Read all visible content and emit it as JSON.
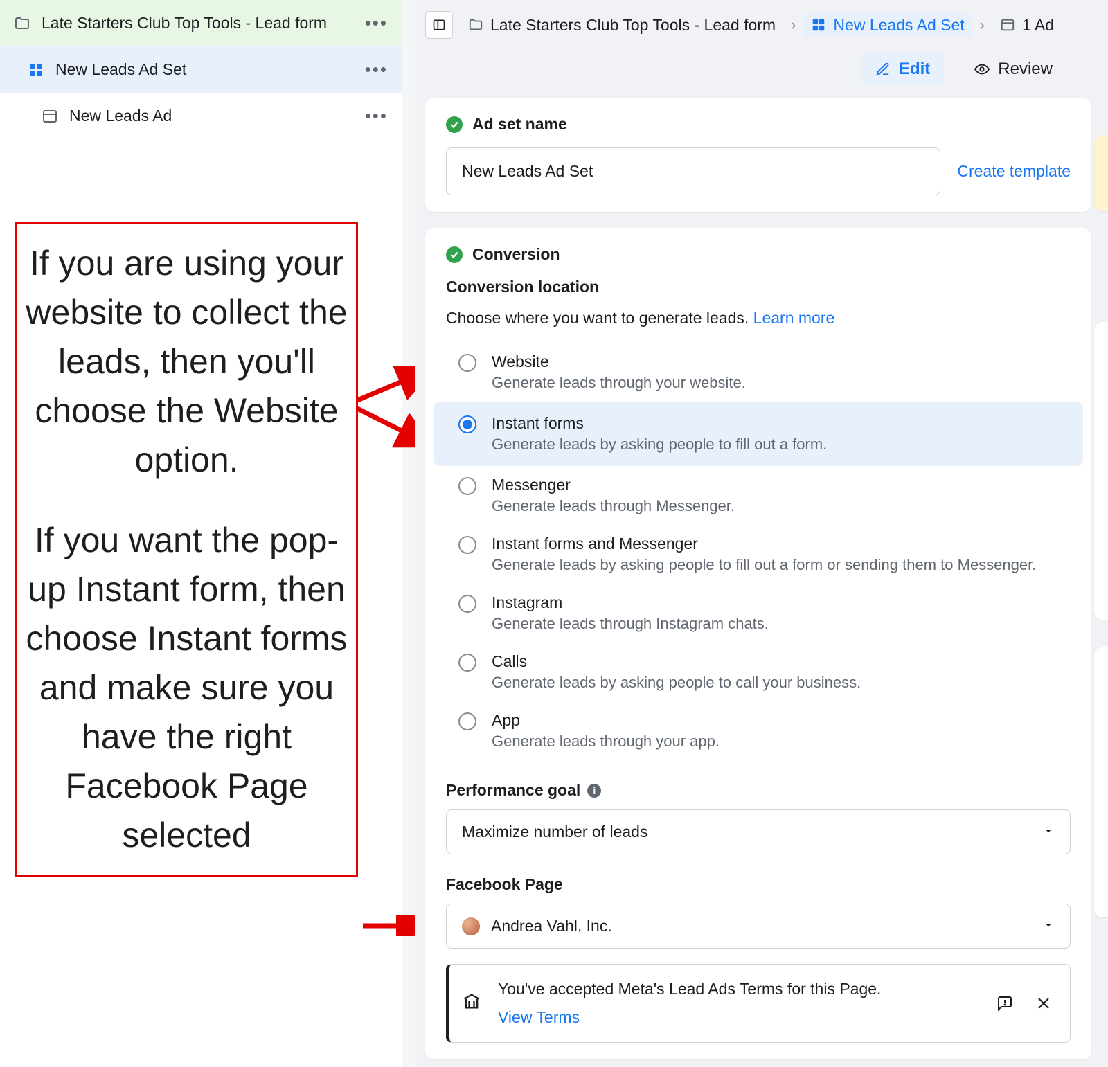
{
  "tree": {
    "campaign": "Late Starters Club Top Tools - Lead form",
    "adset": "New Leads Ad Set",
    "ad": "New Leads Ad"
  },
  "breadcrumb": {
    "campaign": "Late Starters Club Top Tools - Lead form",
    "adset": "New Leads Ad Set",
    "ad": "1 Ad"
  },
  "mode": {
    "edit_label": "Edit",
    "review_label": "Review"
  },
  "adset_card": {
    "title": "Ad set name",
    "value": "New Leads Ad Set",
    "template_link": "Create template"
  },
  "conversion": {
    "title": "Conversion",
    "location_label": "Conversion location",
    "choose_text": "Choose where you want to generate leads. ",
    "learn_more": "Learn more",
    "options": [
      {
        "label": "Website",
        "desc": "Generate leads through your website."
      },
      {
        "label": "Instant forms",
        "desc": "Generate leads by asking people to fill out a form."
      },
      {
        "label": "Messenger",
        "desc": "Generate leads through Messenger."
      },
      {
        "label": "Instant forms and Messenger",
        "desc": "Generate leads by asking people to fill out a form or sending them to Messenger."
      },
      {
        "label": "Instagram",
        "desc": "Generate leads through Instagram chats."
      },
      {
        "label": "Calls",
        "desc": "Generate leads by asking people to call your business."
      },
      {
        "label": "App",
        "desc": "Generate leads through your app."
      }
    ],
    "selected_index": 1,
    "perf_label": "Performance goal",
    "perf_value": "Maximize number of leads",
    "page_label": "Facebook Page",
    "page_value": "Andrea Vahl, Inc.",
    "terms_msg": "You've accepted Meta's Lead Ads Terms for this Page.",
    "view_terms": "View Terms"
  },
  "annotation": {
    "p1": "If you are using your website to collect the leads, then you'll choose the Website option.",
    "p2": "If you want the pop-up Instant form, then choose Instant forms and make sure you have the right Facebook Page selected"
  }
}
